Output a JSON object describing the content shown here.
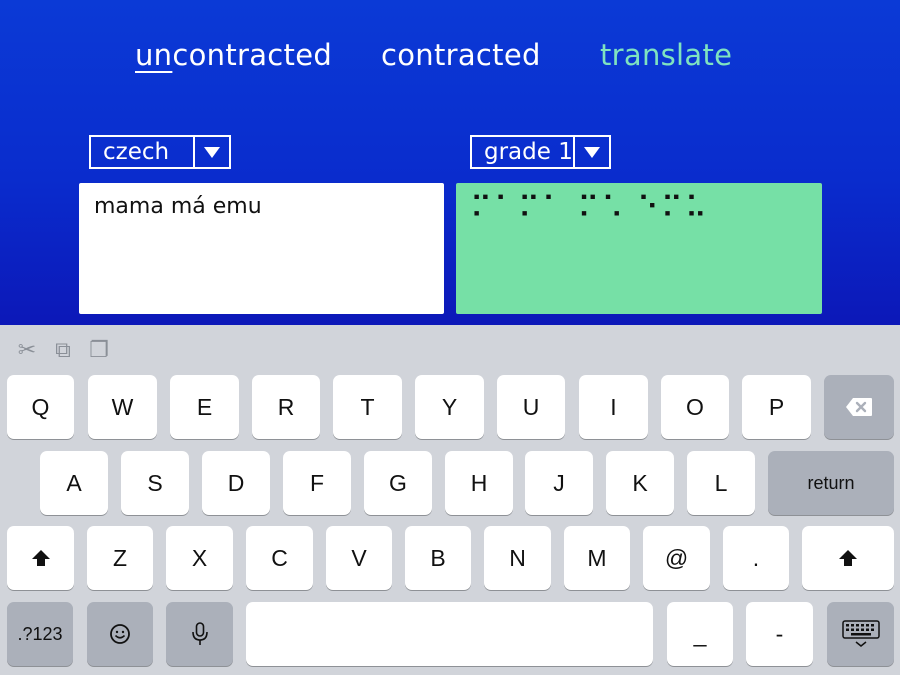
{
  "tabs": {
    "uncontracted_prefix": "un",
    "uncontracted_rest": "contracted",
    "contracted": "contracted",
    "translate": "translate"
  },
  "language_dropdown": {
    "value": "czech"
  },
  "grade_dropdown": {
    "value": "grade 1"
  },
  "input_text": "mama má emu",
  "braille_output": "⠍⠁⠍⠁ ⠍⠡ ⠑⠍⠥",
  "colors": {
    "background_top": "#0b3ad6",
    "background_bottom": "#0c18b8",
    "translate_accent": "#7fe3c0",
    "braille_box": "#76e0a6",
    "keyboard_bg": "#d1d4da"
  },
  "toolbar_icons": [
    "scissors-icon",
    "copy-icon",
    "paste-icon"
  ],
  "keyboard": {
    "row1": [
      "Q",
      "W",
      "E",
      "R",
      "T",
      "Y",
      "U",
      "I",
      "O",
      "P"
    ],
    "row2": [
      "A",
      "S",
      "D",
      "F",
      "G",
      "H",
      "J",
      "K",
      "L"
    ],
    "row3": [
      "Z",
      "X",
      "C",
      "V",
      "B",
      "N",
      "M",
      "@",
      "."
    ],
    "return_label": "return",
    "numbers_label": ".?123",
    "underscore_label": "_",
    "dash_label": "-",
    "icons": {
      "backspace": "backspace-icon",
      "shift": "shift-icon",
      "emoji": "emoji-icon",
      "mic": "microphone-icon",
      "hide": "keyboard-hide-icon"
    }
  }
}
